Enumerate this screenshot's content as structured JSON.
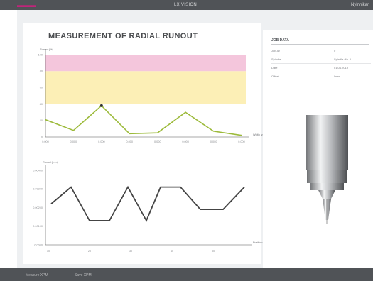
{
  "header": {
    "logo": "▬▬▬",
    "app_title": "LX VISION",
    "user": "Nyinnikar"
  },
  "main": {
    "title": "MEASUREMENT OF RADIAL RUNOUT"
  },
  "colors": {
    "topbar": "#505357",
    "accent": "#c0247a",
    "series_top": "#9cba3a",
    "series_bottom": "#444444",
    "band_pink": "#f4c6dc",
    "band_yellow": "#fcefb6"
  },
  "chart_data": [
    {
      "type": "line",
      "ylabel": "Runout [%]",
      "xlabel": "Width [z-mm]",
      "x": [
        "0.000",
        "0.000",
        "0.000",
        "0.000",
        "0.000",
        "0.000",
        "0.000",
        "0.000"
      ],
      "values": [
        21,
        8,
        38,
        4,
        5,
        30,
        7,
        2
      ],
      "ylim": [
        0,
        100
      ],
      "y_ticks": [
        "0",
        "20",
        "40",
        "60",
        "80",
        "100"
      ],
      "bands": [
        {
          "from": 40,
          "to": 80,
          "color": "#fcefb6"
        },
        {
          "from": 80,
          "to": 100,
          "color": "#f4c6dc"
        }
      ],
      "highlight_index": 2
    },
    {
      "type": "line",
      "ylabel": "Runout [mm]",
      "xlabel": "Position [mm]",
      "x": [
        "10",
        "20",
        "30",
        "40",
        "50"
      ],
      "values": [
        2.2,
        3.1,
        1.3,
        1.3,
        3.1,
        1.3,
        3.1,
        3.1,
        1.9,
        1.9,
        3.1
      ],
      "ylim": [
        0,
        4
      ],
      "y_ticks": [
        "0.0000",
        "0.00100",
        "0.00200",
        "0.00300",
        "0.00400"
      ],
      "x_ticks": [
        "10",
        "20",
        "30",
        "40",
        "50"
      ]
    }
  ],
  "job": {
    "title": "JOB DATA",
    "rows": [
      {
        "k": "Job-ID",
        "v": "0"
      },
      {
        "k": "Spindle",
        "v": "Spindle dia. 1"
      },
      {
        "k": "Date",
        "v": "01.04.2019"
      },
      {
        "k": "Offset",
        "v": "0mm"
      }
    ]
  },
  "footer": {
    "item1": "Measure XPM",
    "item2": "Save XPM"
  }
}
